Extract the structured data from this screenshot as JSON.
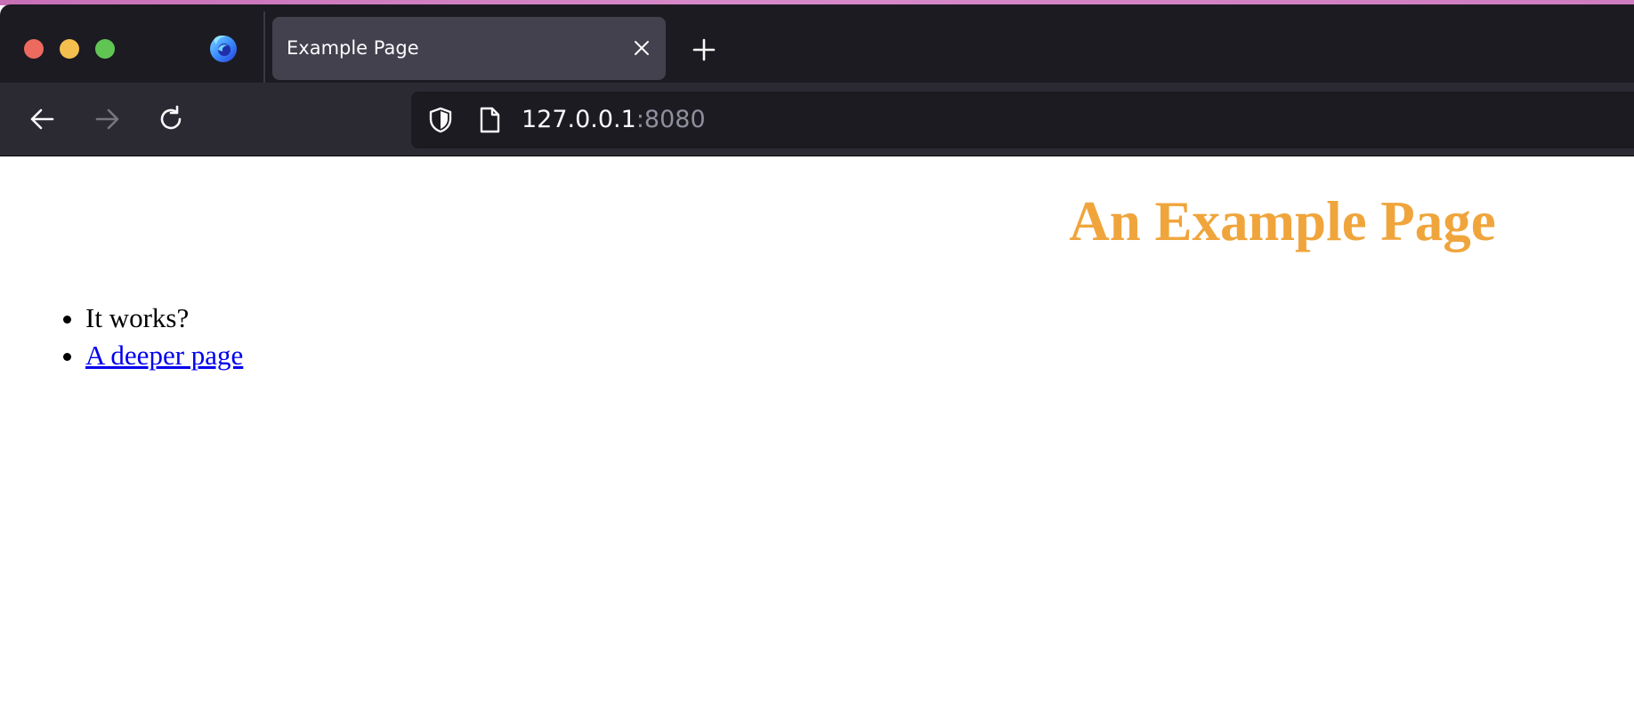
{
  "browser": {
    "tab": {
      "title": "Example Page"
    },
    "url": {
      "host": "127.0.0.1",
      "port": ":8080"
    },
    "icons": {
      "window_close": "close-dot",
      "window_minimize": "minimize-dot",
      "window_maximize": "maximize-dot",
      "browser_logo": "firefox-logo",
      "tab_close": "close-icon",
      "new_tab": "plus-icon",
      "back": "arrow-left-icon",
      "forward": "arrow-right-icon",
      "reload": "reload-icon",
      "tracking_protection": "shield-icon",
      "page_info": "page-icon"
    },
    "colors": {
      "tabbar_bg": "#1c1b22",
      "toolbar_bg": "#2b2a33",
      "active_tab_bg": "#42414d",
      "traffic_red": "#ed6a5e",
      "traffic_yellow": "#f5bf4f",
      "traffic_green": "#61c554"
    }
  },
  "page": {
    "heading": "An Example Page",
    "heading_color": "#f0a53c",
    "items": [
      {
        "text": "It works?"
      },
      {
        "text": "A deeper page",
        "is_link": true
      }
    ],
    "link_color": "#0000ee"
  }
}
